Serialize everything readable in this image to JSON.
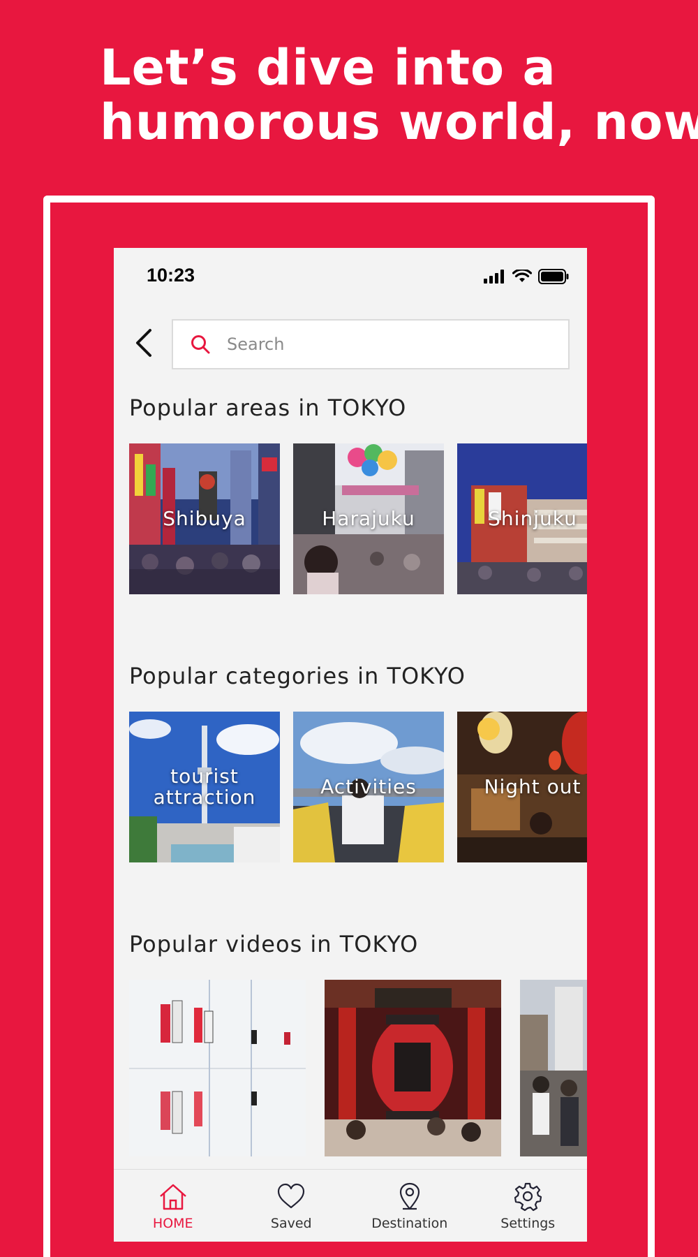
{
  "headline": {
    "line1": "Let’s dive into a",
    "line2": "humorous world, now"
  },
  "status_bar": {
    "time": "10:23"
  },
  "search": {
    "placeholder": "Search"
  },
  "sections": {
    "areas": {
      "title": "Popular areas in TOKYO",
      "items": [
        {
          "label": "Shibuya"
        },
        {
          "label": "Harajuku"
        },
        {
          "label": "Shinjuku"
        }
      ]
    },
    "categories": {
      "title": "Popular categories in TOKYO",
      "items": [
        {
          "label": "tourist attraction"
        },
        {
          "label": "Activities"
        },
        {
          "label": "Night out"
        }
      ]
    },
    "videos": {
      "title": "Popular videos in TOKYO"
    }
  },
  "tabbar": {
    "items": [
      {
        "label": "HOME",
        "icon": "home-icon",
        "active": true
      },
      {
        "label": "Saved",
        "icon": "heart-icon"
      },
      {
        "label": "Destination",
        "icon": "map-pin-icon"
      },
      {
        "label": "Settings",
        "icon": "gear-icon"
      }
    ]
  },
  "colors": {
    "brand": "#E8173F",
    "phone_bg": "#F3F3F3",
    "text": "#222222"
  }
}
